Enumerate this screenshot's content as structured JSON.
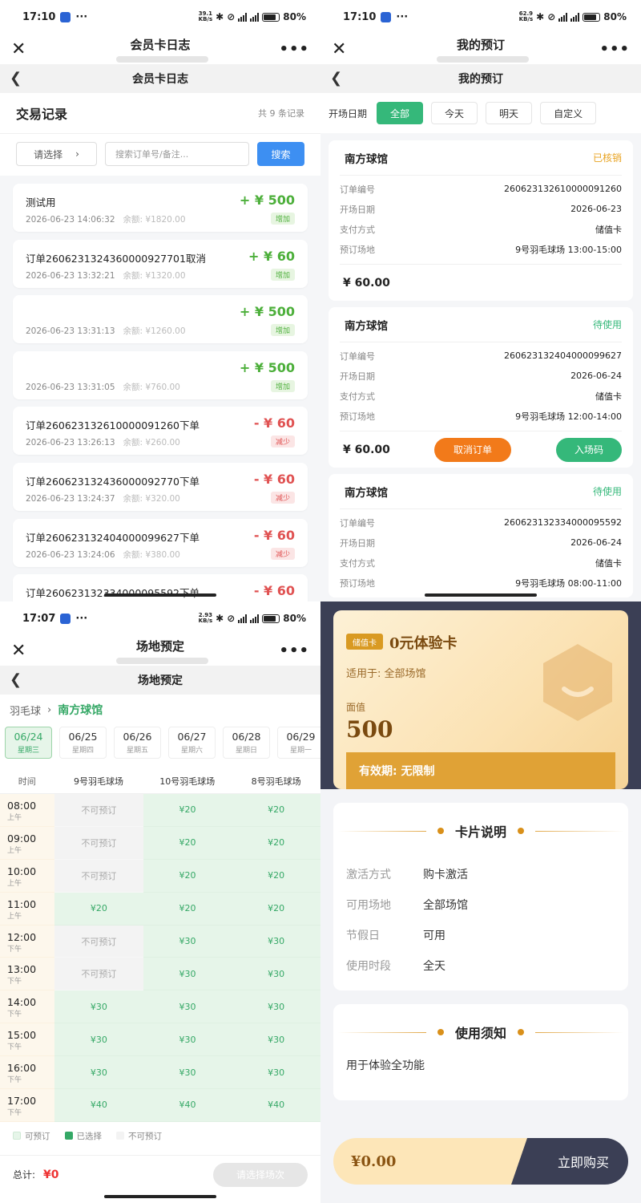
{
  "statusbar": {
    "p1": {
      "time": "17:10",
      "net_top": "39.1",
      "net_bottom": "KB/s",
      "battery": "80%"
    },
    "p2": {
      "time": "17:10",
      "net_top": "62.9",
      "net_bottom": "KB/s",
      "battery": "80%"
    },
    "p3": {
      "time": "17:07",
      "net_top": "2.93",
      "net_bottom": "KB/s",
      "battery": "80%"
    },
    "dots": "···",
    "sig_label": "5G"
  },
  "panel1": {
    "wx_title": "会员卡日志",
    "nav_title": "会员卡日志",
    "section_title": "交易记录",
    "record_count": "共 9 条记录",
    "select_label": "请选择",
    "search_placeholder": "搜索订单号/备注...",
    "search_button": "搜索",
    "balance_label": "余额:",
    "transactions": [
      {
        "name": "测试用",
        "time": "2026-06-23 14:06:32",
        "balance": "¥1820.00",
        "amount": "+ ¥ 500",
        "tag": "增加",
        "type": "inc"
      },
      {
        "name": "订单2606231324360000927701取消",
        "time": "2026-06-23 13:32:21",
        "balance": "¥1320.00",
        "amount": "+ ¥ 60",
        "tag": "增加",
        "type": "inc"
      },
      {
        "name": "",
        "time": "2026-06-23 13:31:13",
        "balance": "¥1260.00",
        "amount": "+ ¥ 500",
        "tag": "增加",
        "type": "inc"
      },
      {
        "name": "",
        "time": "2026-06-23 13:31:05",
        "balance": "¥760.00",
        "amount": "+ ¥ 500",
        "tag": "增加",
        "type": "inc"
      },
      {
        "name": "订单260623132610000091260下单",
        "time": "2026-06-23 13:26:13",
        "balance": "¥260.00",
        "amount": "- ¥ 60",
        "tag": "减少",
        "type": "dec"
      },
      {
        "name": "订单260623132436000092770下单",
        "time": "2026-06-23 13:24:37",
        "balance": "¥320.00",
        "amount": "- ¥ 60",
        "tag": "减少",
        "type": "dec"
      },
      {
        "name": "订单260623132404000099627下单",
        "time": "2026-06-23 13:24:06",
        "balance": "¥380.00",
        "amount": "- ¥ 60",
        "tag": "减少",
        "type": "dec"
      },
      {
        "name": "订单260623132334000095592下单",
        "time": "",
        "balance": "",
        "amount": "- ¥ 60",
        "tag": "",
        "type": "dec"
      }
    ]
  },
  "panel2": {
    "wx_title": "我的预订",
    "nav_title": "我的预订",
    "filter_label": "开场日期",
    "filters": [
      "全部",
      "今天",
      "明天",
      "自定义"
    ],
    "keys": {
      "order_no": "订单编号",
      "date": "开场日期",
      "pay": "支付方式",
      "venue": "预订场地"
    },
    "orders": [
      {
        "venue_name": "南方球馆",
        "status": "已核销",
        "status_type": "used",
        "order_no": "260623132610000091260",
        "date": "2026-06-23",
        "pay": "储值卡",
        "court": "9号羽毛球场 13:00-15:00",
        "price": "¥ 60.00"
      },
      {
        "venue_name": "南方球馆",
        "status": "待使用",
        "status_type": "wait",
        "order_no": "260623132404000099627",
        "date": "2026-06-24",
        "pay": "储值卡",
        "court": "9号羽毛球场 12:00-14:00",
        "price": "¥ 60.00",
        "cancel": "取消订单",
        "code": "入场码"
      },
      {
        "venue_name": "南方球馆",
        "status": "待使用",
        "status_type": "wait",
        "order_no": "260623132334000095592",
        "date": "2026-06-24",
        "pay": "储值卡",
        "court": "9号羽毛球场 08:00-11:00"
      }
    ]
  },
  "panel3": {
    "wx_title": "场地预定",
    "nav_title": "场地预定",
    "crumb_sport": "羽毛球",
    "crumb_venue": "南方球馆",
    "dates": [
      {
        "d": "06/24",
        "w": "星期三"
      },
      {
        "d": "06/25",
        "w": "星期四"
      },
      {
        "d": "06/26",
        "w": "星期五"
      },
      {
        "d": "06/27",
        "w": "星期六"
      },
      {
        "d": "06/28",
        "w": "星期日"
      },
      {
        "d": "06/29",
        "w": "星期一"
      }
    ],
    "time_header": "时间",
    "courts": [
      "9号羽毛球场",
      "10号羽毛球场",
      "8号羽毛球场"
    ],
    "rows": [
      {
        "h": "08:00",
        "ap": "上午",
        "cells": [
          "不可预订",
          "¥20",
          "¥20"
        ]
      },
      {
        "h": "09:00",
        "ap": "上午",
        "cells": [
          "不可预订",
          "¥20",
          "¥20"
        ]
      },
      {
        "h": "10:00",
        "ap": "上午",
        "cells": [
          "不可预订",
          "¥20",
          "¥20"
        ]
      },
      {
        "h": "11:00",
        "ap": "上午",
        "cells": [
          "¥20",
          "¥20",
          "¥20"
        ]
      },
      {
        "h": "12:00",
        "ap": "下午",
        "cells": [
          "不可预订",
          "¥30",
          "¥30"
        ]
      },
      {
        "h": "13:00",
        "ap": "下午",
        "cells": [
          "不可预订",
          "¥30",
          "¥30"
        ]
      },
      {
        "h": "14:00",
        "ap": "下午",
        "cells": [
          "¥30",
          "¥30",
          "¥30"
        ]
      },
      {
        "h": "15:00",
        "ap": "下午",
        "cells": [
          "¥30",
          "¥30",
          "¥30"
        ]
      },
      {
        "h": "16:00",
        "ap": "下午",
        "cells": [
          "¥30",
          "¥30",
          "¥30"
        ]
      },
      {
        "h": "17:00",
        "ap": "下午",
        "cells": [
          "¥40",
          "¥40",
          "¥40"
        ]
      }
    ],
    "legend": {
      "free": "可预订",
      "selected": "已选择",
      "na": "不可预订"
    },
    "total_label": "总计:",
    "total_value": "¥0",
    "pick_button": "请选择场次"
  },
  "panel4": {
    "badge": "储值卡",
    "card_name": "0元体验卡",
    "scope": "适用于: 全部场馆",
    "face_label": "面值",
    "face_value": "500",
    "validity": "有效期: 无限制",
    "desc_title": "卡片说明",
    "info": [
      {
        "k": "激活方式",
        "v": "购卡激活"
      },
      {
        "k": "可用场地",
        "v": "全部场馆"
      },
      {
        "k": "节假日",
        "v": "可用"
      },
      {
        "k": "使用时段",
        "v": "全天"
      }
    ],
    "notice_title": "使用须知",
    "notice_text": "用于体验全功能",
    "price": "¥0.00",
    "buy_button": "立即购买"
  },
  "colors": {
    "green": "#35b87a",
    "orange": "#f27a1a",
    "blue": "#3d8ff2",
    "gold": "#d99a22",
    "navy": "#3b3f55"
  }
}
